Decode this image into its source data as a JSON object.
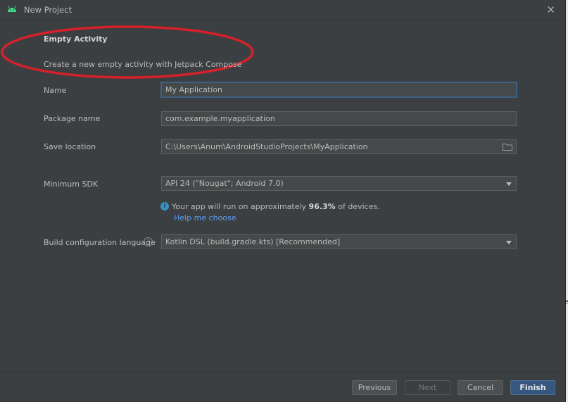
{
  "window": {
    "title": "New Project"
  },
  "template": {
    "heading": "Empty Activity",
    "description": "Create a new empty activity with Jetpack Compose"
  },
  "form": {
    "name_label": "Name",
    "name_value": "My Application",
    "package_label": "Package name",
    "package_value": "com.example.myapplication",
    "save_label": "Save location",
    "save_value": "C:\\Users\\Anum\\AndroidStudioProjects\\MyApplication",
    "min_sdk_label": "Minimum SDK",
    "min_sdk_value": "API 24 (\"Nougat\"; Android 7.0)",
    "info_prefix": "Your app will run on approximately ",
    "info_percent": "96.3%",
    "info_suffix": " of devices.",
    "help_link": "Help me choose",
    "build_label": "Build configuration language",
    "build_value": "Kotlin DSL (build.gradle.kts) [Recommended]"
  },
  "footer": {
    "previous": "Previous",
    "next": "Next",
    "cancel": "Cancel",
    "finish": "Finish"
  },
  "side_strip_char": "e",
  "colors": {
    "background": "#3c3f41",
    "field": "#45494a",
    "focus": "#3d6185",
    "link": "#589df6",
    "primary_button": "#365880",
    "annotation_oval": "#d8202a",
    "android_green": "#3ddc84"
  },
  "icons": [
    "android-icon",
    "close-icon",
    "folder-icon",
    "dropdown-icon",
    "info-icon",
    "help-icon"
  ]
}
